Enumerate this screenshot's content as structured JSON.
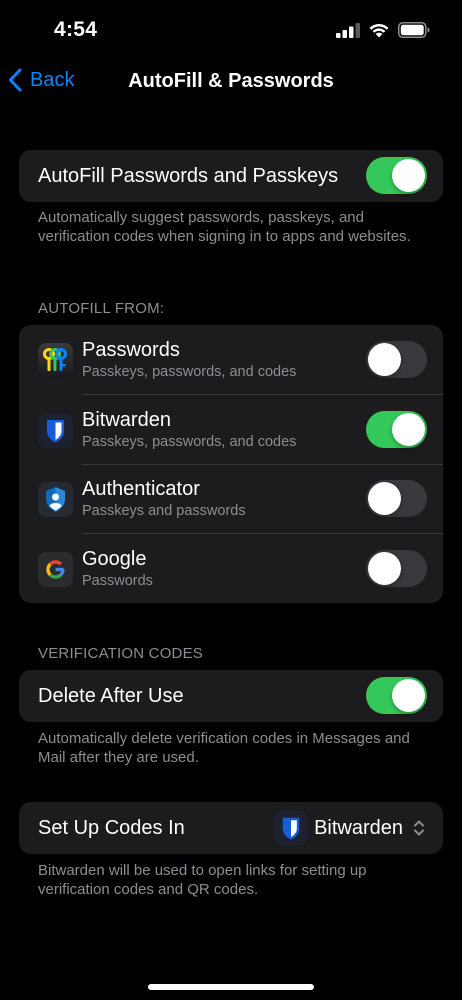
{
  "status": {
    "time": "4:54"
  },
  "nav": {
    "back_label": "Back",
    "title": "AutoFill & Passwords"
  },
  "autofill": {
    "label": "AutoFill Passwords and Passkeys",
    "enabled": true,
    "footer": "Automatically suggest passwords, passkeys, and verification codes when signing in to apps and websites."
  },
  "autofill_from": {
    "header": "AUTOFILL FROM:",
    "items": [
      {
        "title": "Passwords",
        "subtitle": "Passkeys, passwords, and codes",
        "enabled": false,
        "icon": "passwords-app-icon"
      },
      {
        "title": "Bitwarden",
        "subtitle": "Passkeys, passwords, and codes",
        "enabled": true,
        "icon": "bitwarden-app-icon"
      },
      {
        "title": "Authenticator",
        "subtitle": "Passkeys and passwords",
        "enabled": false,
        "icon": "authenticator-app-icon"
      },
      {
        "title": "Google",
        "subtitle": "Passwords",
        "enabled": false,
        "icon": "google-app-icon"
      }
    ]
  },
  "verification": {
    "header": "VERIFICATION CODES",
    "delete_label": "Delete After Use",
    "delete_enabled": true,
    "delete_footer": "Automatically delete verification codes in Messages and Mail after they are used.",
    "setup_label": "Set Up Codes In",
    "setup_value": "Bitwarden",
    "setup_footer": "Bitwarden will be used to open links for setting up verification codes and QR codes."
  },
  "colors": {
    "accent": "#0a84ff",
    "toggle_on": "#34c759",
    "toggle_off": "#39393d",
    "cell_bg": "#1c1c1e",
    "secondary_text": "#8d8d93"
  }
}
